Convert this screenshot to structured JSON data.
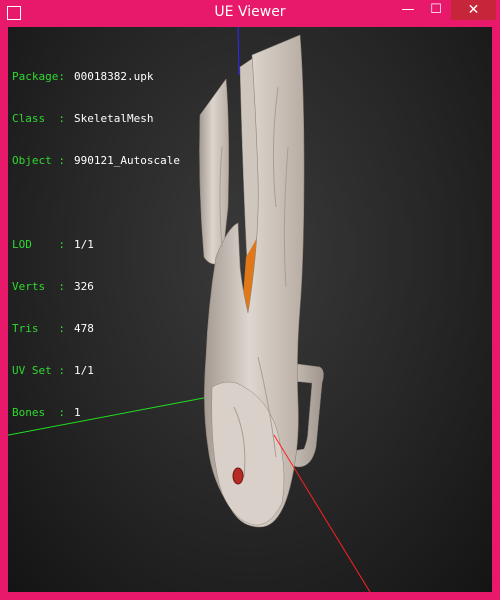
{
  "window": {
    "title": "UE Viewer",
    "minimize_glyph": "—",
    "maximize_glyph": "☐",
    "close_glyph": "✕",
    "frame_color": "#e8186a"
  },
  "info": {
    "package_key": "Package:",
    "package_value": "00018382.upk",
    "class_key": "Class  :",
    "class_value": "SkeletalMesh",
    "object_key": "Object :",
    "object_value": "990121_Autoscale",
    "lod_key": "LOD    :",
    "lod_value": "1/1",
    "verts_key": "Verts  :",
    "verts_value": "326",
    "tris_key": "Tris   :",
    "tris_value": "478",
    "uvset_key": "UV Set :",
    "uvset_value": "1/1",
    "bones_key": "Bones  :",
    "bones_value": "1"
  },
  "colors": {
    "label": "#2fd92f",
    "value": "#ffffff",
    "axis_x": "#ff2020",
    "axis_y": "#20e020",
    "axis_z": "#2020ff",
    "mesh": "#d8d0c8",
    "accent": "#e07818"
  }
}
